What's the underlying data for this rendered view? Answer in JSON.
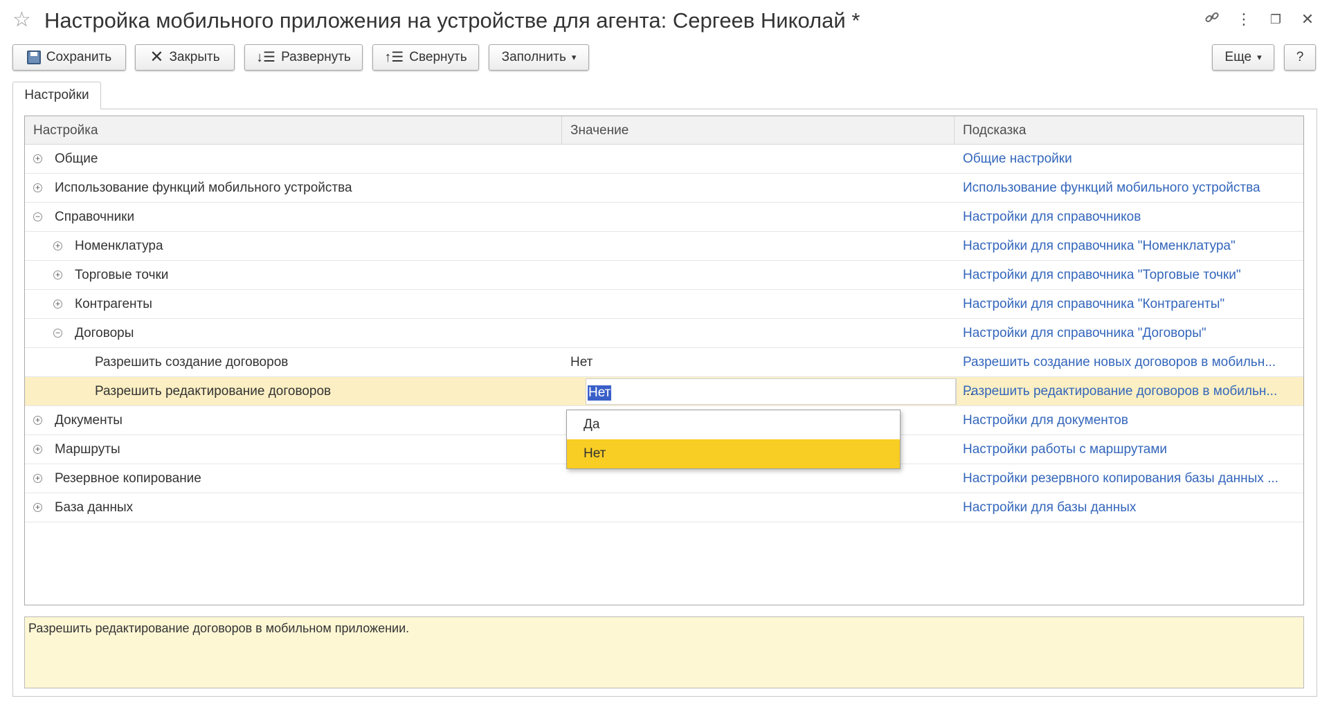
{
  "window": {
    "title": "Настройка мобильного приложения на устройстве для агента: Сергеев Николай *",
    "icons": [
      "star-icon",
      "link-icon",
      "more-vertical-icon",
      "restore-icon",
      "close-icon"
    ]
  },
  "toolbar": {
    "save_label": "Сохранить",
    "close_label": "Закрыть",
    "expand_label": "Развернуть",
    "collapse_label": "Свернуть",
    "fill_label": "Заполнить",
    "more_label": "Еще",
    "help_label": "?"
  },
  "tabs": [
    {
      "label": "Настройки",
      "active": true
    }
  ],
  "table": {
    "columns": [
      "Настройка",
      "Значение",
      "Подсказка"
    ],
    "rows": [
      {
        "name": "Общие",
        "value": "",
        "hint": "Общие настройки",
        "level": 0,
        "toggle": "+"
      },
      {
        "name": "Использование функций мобильного устройства",
        "value": "",
        "hint": "Использование функций мобильного устройства",
        "level": 0,
        "toggle": "+"
      },
      {
        "name": "Справочники",
        "value": "",
        "hint": "Настройки для справочников",
        "level": 0,
        "toggle": "−"
      },
      {
        "name": "Номенклатура",
        "value": "",
        "hint": "Настройки для справочника \"Номенклатура\"",
        "level": 1,
        "toggle": "+"
      },
      {
        "name": "Торговые точки",
        "value": "",
        "hint": "Настройки для справочника \"Торговые точки\"",
        "level": 1,
        "toggle": "+"
      },
      {
        "name": "Контрагенты",
        "value": "",
        "hint": "Настройки для справочника \"Контрагенты\"",
        "level": 1,
        "toggle": "+"
      },
      {
        "name": "Договоры",
        "value": "",
        "hint": "Настройки для справочника \"Договоры\"",
        "level": 1,
        "toggle": "−"
      },
      {
        "name": "Разрешить создание договоров",
        "value": "Нет",
        "hint": "Разрешить создание новых договоров в мобильн...",
        "level": 2,
        "toggle": ""
      },
      {
        "name": "Разрешить редактирование договоров",
        "value": "Нет",
        "hint": "Разрешить редактирование договоров в мобильн...",
        "level": 2,
        "toggle": "",
        "selected": true,
        "editing": true
      },
      {
        "name": "Документы",
        "value": "",
        "hint": "Настройки для документов",
        "level": 0,
        "toggle": "+"
      },
      {
        "name": "Маршруты",
        "value": "",
        "hint": "Настройки работы с маршрутами",
        "level": 0,
        "toggle": "+"
      },
      {
        "name": "Резервное копирование",
        "value": "",
        "hint": "Настройки резервного копирования базы данных ...",
        "level": 0,
        "toggle": "+"
      },
      {
        "name": "База данных",
        "value": "",
        "hint": "Настройки для базы данных",
        "level": 0,
        "toggle": "+"
      }
    ],
    "editor_button_label": "..."
  },
  "dropdown": {
    "options": [
      "Да",
      "Нет"
    ],
    "selected": "Нет"
  },
  "description": "Разрешить редактирование договоров в мобильном приложении.",
  "colors": {
    "hint_link": "#3366bb",
    "selected_row": "#fbefc3",
    "dropdown_active": "#f8cd24",
    "text_selection": "#3a5fc8",
    "description_bg": "#fdf7d4"
  }
}
